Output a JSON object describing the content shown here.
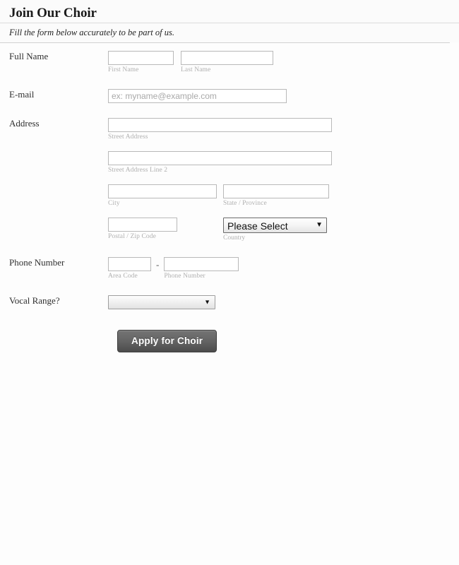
{
  "form": {
    "title": "Join Our Choir",
    "subtitle": "Fill the form below accurately to be part of us.",
    "fields": {
      "full_name": {
        "label": "Full Name",
        "first": {
          "sub_label": "First Name",
          "value": "",
          "placeholder": ""
        },
        "last": {
          "sub_label": "Last Name",
          "value": "",
          "placeholder": ""
        }
      },
      "email": {
        "label": "E-mail",
        "value": "",
        "placeholder": "ex: myname@example.com"
      },
      "address": {
        "label": "Address",
        "street": {
          "sub_label": "Street Address",
          "value": "",
          "placeholder": ""
        },
        "street2": {
          "sub_label": "Street Address Line 2",
          "value": "",
          "placeholder": ""
        },
        "city": {
          "sub_label": "City",
          "value": "",
          "placeholder": ""
        },
        "state": {
          "sub_label": "State / Province",
          "value": "",
          "placeholder": ""
        },
        "postal": {
          "sub_label": "Postal / Zip Code",
          "value": "",
          "placeholder": ""
        },
        "country": {
          "sub_label": "Country",
          "selected": "Please Select",
          "options": [
            "Please Select"
          ]
        }
      },
      "phone": {
        "label": "Phone Number",
        "separator": "-",
        "area_code": {
          "sub_label": "Area Code",
          "value": "",
          "placeholder": ""
        },
        "number": {
          "sub_label": "Phone Number",
          "value": "",
          "placeholder": ""
        }
      },
      "vocal_range": {
        "label": "Vocal Range?",
        "selected": "",
        "options": [
          ""
        ]
      }
    },
    "submit_label": "Apply for Choir",
    "colors": {
      "page_background": "#fdfdfd",
      "header_background": "#fbfbfb",
      "label_text": "#2f2f2f",
      "sub_label_text": "#b0b0b0",
      "input_border": "#b9b9b9",
      "rule": "#d2d2d2",
      "button_top": "#747474",
      "button_bottom": "#4c4c4c",
      "button_text": "#ffffff"
    },
    "icons": {
      "dropdown_arrow": "▼"
    }
  }
}
